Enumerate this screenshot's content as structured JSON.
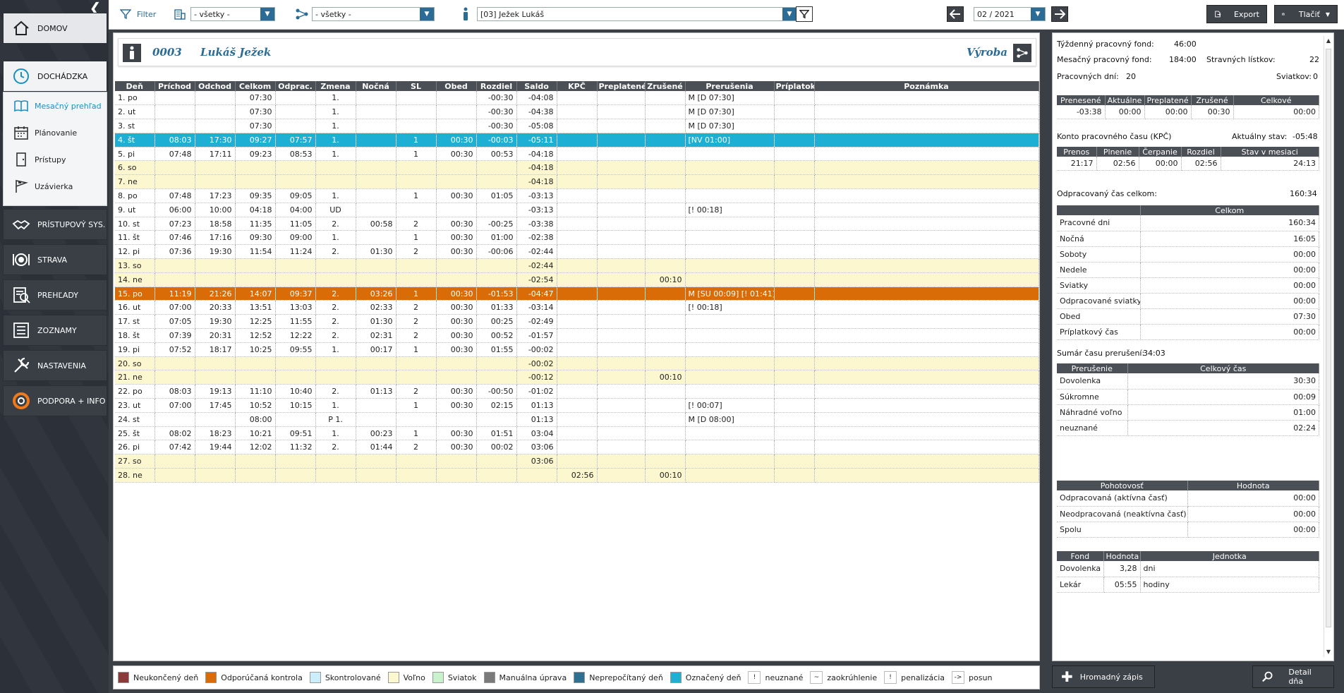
{
  "sidebar": {
    "items": [
      {
        "name": "domov",
        "label": "DOMOV",
        "icon": "home-icon"
      },
      {
        "name": "dochadzka",
        "label": "DOCHÁDZKA",
        "icon": "clock-icon"
      },
      {
        "name": "pristupovy",
        "label": "PRÍSTUPOVÝ SYS.",
        "icon": "handshake-icon"
      },
      {
        "name": "strava",
        "label": "STRAVA",
        "icon": "plate-icon"
      },
      {
        "name": "prehlady",
        "label": "PREHĽADY",
        "icon": "report-icon"
      },
      {
        "name": "zoznamy",
        "label": "ZOZNAMY",
        "icon": "list-icon"
      },
      {
        "name": "nastavenia",
        "label": "NASTAVENIA",
        "icon": "tools-icon"
      },
      {
        "name": "podpora",
        "label": "PODPORA + INFO",
        "icon": "lifebuoy-icon"
      }
    ],
    "sub_items": [
      {
        "label": "Mesačný prehľad",
        "icon": "book-icon",
        "selected": true
      },
      {
        "label": "Plánovanie",
        "icon": "calendar-icon",
        "selected": false
      },
      {
        "label": "Prístupy",
        "icon": "door-icon",
        "selected": false
      },
      {
        "label": "Uzávierka",
        "icon": "flag-icon",
        "selected": false
      }
    ]
  },
  "toolbar": {
    "filter_label": "Filter",
    "dept_value": "- všetky -",
    "group_value": "- všetky -",
    "employee_value": "[03] Ježek Lukáš",
    "period_value": "02 / 2021",
    "export_label": "Export",
    "print_label": "Tlačiť"
  },
  "header": {
    "code": "0003",
    "name": "Lukáš Ježek",
    "department": "Výroba"
  },
  "columns": [
    "Deň",
    "Príchod",
    "Odchod",
    "Celkom",
    "Odprac.",
    "Zmena",
    "Nočná",
    "SL",
    "Obed",
    "Rozdiel",
    "Saldo",
    "KPČ",
    "Preplatené",
    "Zrušené",
    "Prerušenia",
    "Príplatok",
    "Poznámka"
  ],
  "rows": [
    {
      "kind": "n",
      "c": [
        "1. po",
        "",
        "",
        "07:30",
        "",
        "1.",
        "",
        "",
        "",
        "-00:30",
        "-04:08",
        "",
        "",
        "",
        "M [D 07:30]",
        "",
        ""
      ]
    },
    {
      "kind": "n",
      "c": [
        "2. ut",
        "",
        "",
        "07:30",
        "",
        "1.",
        "",
        "",
        "",
        "-00:30",
        "-04:38",
        "",
        "",
        "",
        "M [D 07:30]",
        "",
        ""
      ]
    },
    {
      "kind": "n",
      "c": [
        "3. st",
        "",
        "",
        "07:30",
        "",
        "1.",
        "",
        "",
        "",
        "-00:30",
        "-05:08",
        "",
        "",
        "",
        "M [D 07:30]",
        "",
        ""
      ]
    },
    {
      "kind": "mk",
      "c": [
        "4. št",
        "08:03",
        "17:30",
        "09:27",
        "07:57",
        "1.",
        "",
        "1",
        "00:30",
        "-00:03",
        "-05:11",
        "",
        "",
        "",
        "[NV 01:00]",
        "",
        ""
      ]
    },
    {
      "kind": "n",
      "c": [
        "5. pi",
        "07:48",
        "17:11",
        "09:23",
        "08:53",
        "1.",
        "",
        "1",
        "00:30",
        "00:53",
        "-04:18",
        "",
        "",
        "",
        "",
        "",
        ""
      ]
    },
    {
      "kind": "we",
      "c": [
        "6. so",
        "",
        "",
        "",
        "",
        "",
        "",
        "",
        "",
        "",
        "-04:18",
        "",
        "",
        "",
        "",
        "",
        ""
      ]
    },
    {
      "kind": "we",
      "c": [
        "7. ne",
        "",
        "",
        "",
        "",
        "",
        "",
        "",
        "",
        "",
        "-04:18",
        "",
        "",
        "",
        "",
        "",
        ""
      ]
    },
    {
      "kind": "n",
      "c": [
        "8. po",
        "07:48",
        "17:23",
        "09:35",
        "09:05",
        "1.",
        "",
        "1",
        "00:30",
        "01:05",
        "-03:13",
        "",
        "",
        "",
        "",
        "",
        ""
      ]
    },
    {
      "kind": "n",
      "c": [
        "9. ut",
        "06:00",
        "10:00",
        "04:18",
        "04:00",
        "UD",
        "",
        "",
        "",
        "",
        "-03:13",
        "",
        "",
        "",
        "[! 00:18]",
        "",
        ""
      ]
    },
    {
      "kind": "n",
      "c": [
        "10. st",
        "07:23",
        "18:58",
        "11:35",
        "11:05",
        "2.",
        "00:58",
        "2",
        "00:30",
        "-00:25",
        "-03:38",
        "",
        "",
        "",
        "",
        "",
        ""
      ]
    },
    {
      "kind": "n",
      "c": [
        "11. št",
        "07:46",
        "17:16",
        "09:30",
        "09:00",
        "1.",
        "",
        "1",
        "00:30",
        "01:00",
        "-02:38",
        "",
        "",
        "",
        "",
        "",
        ""
      ]
    },
    {
      "kind": "n",
      "c": [
        "12. pi",
        "07:36",
        "19:30",
        "11:54",
        "11:24",
        "2.",
        "01:30",
        "2",
        "00:30",
        "-00:06",
        "-02:44",
        "",
        "",
        "",
        "",
        "",
        ""
      ]
    },
    {
      "kind": "we",
      "c": [
        "13. so",
        "",
        "",
        "",
        "",
        "",
        "",
        "",
        "",
        "",
        "-02:44",
        "",
        "",
        "",
        "",
        "",
        ""
      ]
    },
    {
      "kind": "we",
      "c": [
        "14. ne",
        "",
        "",
        "",
        "",
        "",
        "",
        "",
        "",
        "",
        "-02:54",
        "",
        "",
        "00:10",
        "",
        "",
        ""
      ]
    },
    {
      "kind": "rec",
      "c": [
        "15. po",
        "11:19",
        "21:26",
        "14:07",
        "09:37",
        "2.",
        "03:26",
        "1",
        "00:30",
        "-01:53",
        "-04:47",
        "",
        "",
        "",
        "M [SU 00:09] [! 01:41]",
        "",
        ""
      ]
    },
    {
      "kind": "n",
      "c": [
        "16. ut",
        "07:00",
        "20:33",
        "13:51",
        "13:03",
        "2.",
        "02:33",
        "2",
        "00:30",
        "01:33",
        "-03:14",
        "",
        "",
        "",
        "[! 00:18]",
        "",
        ""
      ]
    },
    {
      "kind": "n",
      "c": [
        "17. st",
        "07:05",
        "19:30",
        "12:25",
        "11:55",
        "2.",
        "01:30",
        "2",
        "00:30",
        "00:25",
        "-02:49",
        "",
        "",
        "",
        "",
        "",
        ""
      ]
    },
    {
      "kind": "n",
      "c": [
        "18. št",
        "07:39",
        "20:31",
        "12:52",
        "12:22",
        "2.",
        "02:31",
        "2",
        "00:30",
        "00:52",
        "-01:57",
        "",
        "",
        "",
        "",
        "",
        ""
      ]
    },
    {
      "kind": "n",
      "c": [
        "19. pi",
        "07:52",
        "18:17",
        "10:25",
        "09:55",
        "1.",
        "00:17",
        "1",
        "00:30",
        "01:55",
        "-00:02",
        "",
        "",
        "",
        "",
        "",
        ""
      ]
    },
    {
      "kind": "we",
      "c": [
        "20. so",
        "",
        "",
        "",
        "",
        "",
        "",
        "",
        "",
        "",
        "-00:02",
        "",
        "",
        "",
        "",
        "",
        ""
      ]
    },
    {
      "kind": "we",
      "c": [
        "21. ne",
        "",
        "",
        "",
        "",
        "",
        "",
        "",
        "",
        "",
        "-00:12",
        "",
        "",
        "00:10",
        "",
        "",
        ""
      ]
    },
    {
      "kind": "n",
      "c": [
        "22. po",
        "08:03",
        "19:13",
        "11:10",
        "10:40",
        "2.",
        "01:13",
        "2",
        "00:30",
        "-00:50",
        "-01:02",
        "",
        "",
        "",
        "",
        "",
        ""
      ]
    },
    {
      "kind": "n",
      "c": [
        "23. ut",
        "07:00",
        "17:45",
        "10:52",
        "10:15",
        "1.",
        "",
        "1",
        "00:30",
        "02:15",
        "01:13",
        "",
        "",
        "",
        "[! 00:07]",
        "",
        ""
      ]
    },
    {
      "kind": "n",
      "c": [
        "24. st",
        "",
        "",
        "08:00",
        "",
        "P 1.",
        "",
        "",
        "",
        "",
        "01:13",
        "",
        "",
        "",
        "M [D 08:00]",
        "",
        ""
      ]
    },
    {
      "kind": "n",
      "c": [
        "25. št",
        "08:02",
        "18:23",
        "10:21",
        "09:51",
        "1.",
        "00:23",
        "1",
        "00:30",
        "01:51",
        "03:04",
        "",
        "",
        "",
        "",
        "",
        ""
      ]
    },
    {
      "kind": "n",
      "c": [
        "26. pi",
        "07:42",
        "19:44",
        "12:02",
        "11:32",
        "2.",
        "01:44",
        "2",
        "00:30",
        "00:02",
        "03:06",
        "",
        "",
        "",
        "",
        "",
        ""
      ]
    },
    {
      "kind": "we",
      "c": [
        "27. so",
        "",
        "",
        "",
        "",
        "",
        "",
        "",
        "",
        "",
        "03:06",
        "",
        "",
        "",
        "",
        "",
        ""
      ]
    },
    {
      "kind": "we",
      "c": [
        "28. ne",
        "",
        "",
        "",
        "",
        "",
        "",
        "",
        "",
        "",
        "",
        "02:56",
        "",
        "00:10",
        "",
        "",
        ""
      ]
    }
  ],
  "summary": {
    "weekly_label": "Týždenný pracovný fond:",
    "weekly_value": "46:00",
    "monthly_label": "Mesačný pracovný fond:",
    "monthly_value": "184:00",
    "meal_label": "Stravných lístkov:",
    "meal_value": "22",
    "workdays_label": "Pracovných dní:",
    "workdays_value": "20",
    "holidays_label": "Sviatkov:",
    "holidays_value": "0",
    "balance_cols": [
      "Prenesené",
      "Aktuálne",
      "Preplatené",
      "Zrušené",
      "Celkové"
    ],
    "balance_vals": [
      "-03:38",
      "00:00",
      "00:00",
      "00:30",
      "00:00"
    ],
    "kpc_label": "Konto pracovného času (KPČ)",
    "kpc_state_label": "Aktuálny stav:",
    "kpc_state_value": "-05:48",
    "kpc_cols": [
      "Prenos",
      "Plnenie",
      "Čerpanie",
      "Rozdiel",
      "Stav v mesiaci"
    ],
    "kpc_vals": [
      "21:17",
      "02:56",
      "00:00",
      "02:56",
      "24:13"
    ],
    "worked_label": "Odpracovaný čas celkom:",
    "worked_value": "160:34",
    "worked_col": "Celkom",
    "worked_rows": [
      [
        "Pracovné dni",
        "160:34"
      ],
      [
        "Nočná",
        "16:05"
      ],
      [
        "Soboty",
        "00:00"
      ],
      [
        "Nedele",
        "00:00"
      ],
      [
        "Sviatky",
        "00:00"
      ],
      [
        "Odpracované sviatky",
        "00:00"
      ],
      [
        "Obed",
        "07:30"
      ],
      [
        "Príplatkový čas",
        "00:00"
      ]
    ],
    "interrupt_label": "Sumár času prerušení:",
    "interrupt_value": "34:03",
    "interrupt_cols": [
      "Prerušenie",
      "Celkový čas"
    ],
    "interrupt_rows": [
      [
        "Dovolenka",
        "30:30"
      ],
      [
        "Súkromne",
        "00:09"
      ],
      [
        "Náhradné voľno",
        "01:00"
      ],
      [
        "neuznané",
        "02:24"
      ]
    ],
    "standby_cols": [
      "Pohotovosť",
      "Hodnota"
    ],
    "standby_rows": [
      [
        "Odpracovaná (aktívna časť)",
        "00:00"
      ],
      [
        "Neodpracovaná (neaktívna časť)",
        "00:00"
      ],
      [
        "Spolu",
        "00:00"
      ]
    ],
    "fund_cols": [
      "Fond",
      "Hodnota",
      "Jednotka"
    ],
    "fund_rows": [
      [
        "Dovolenka",
        "3,28",
        "dni"
      ],
      [
        "Lekár",
        "05:55",
        "hodiny"
      ]
    ]
  },
  "legend": [
    {
      "label": "Neukončený deň",
      "color": "#8b3a3a"
    },
    {
      "label": "Odporúčaná kontrola",
      "color": "#d96c06"
    },
    {
      "label": "Skontrolované",
      "color": "#cceefa"
    },
    {
      "label": "Voľno",
      "color": "#fdf7cf"
    },
    {
      "label": "Sviatok",
      "color": "#c9f2cc"
    },
    {
      "label": "Manuálna úprava",
      "color": "#7a7a7a"
    },
    {
      "label": "Neprepočítaný deň",
      "color": "#2f6f8f"
    },
    {
      "label": "Označený deň",
      "color": "#1eb0d4"
    }
  ],
  "legend_glyphs": [
    {
      "glyph": "!",
      "label": "neuznané"
    },
    {
      "glyph": "~",
      "label": "zaokrúhlenie"
    },
    {
      "glyph": "!",
      "label": "penalizácia"
    },
    {
      "glyph": "->",
      "label": "posun"
    }
  ],
  "buttons": {
    "bulk": "Hromadný zápis",
    "detail": "Detail dňa"
  }
}
